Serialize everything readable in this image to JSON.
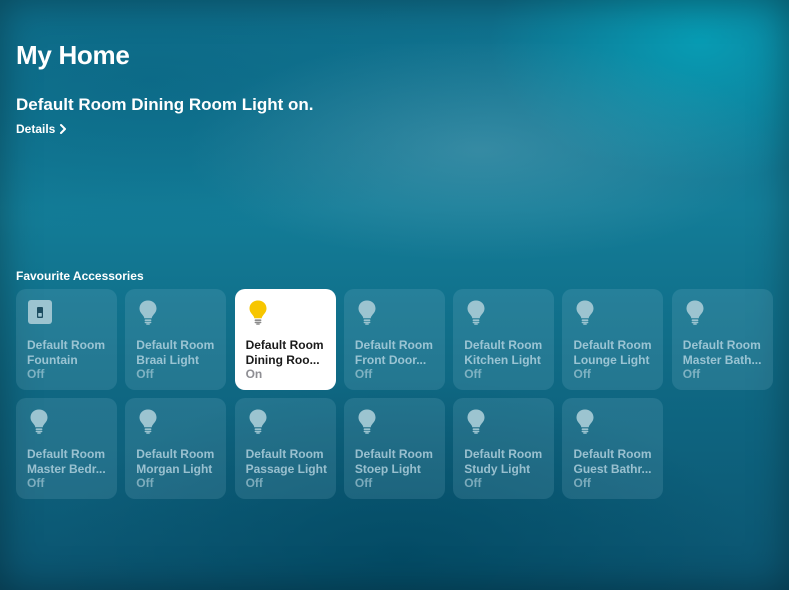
{
  "header": {
    "title": "My Home",
    "status_message": "Default Room Dining Room Light on.",
    "details_link": "Details"
  },
  "favourites": {
    "section_title": "Favourite Accessories",
    "accessories": [
      {
        "line1": "Default Room",
        "line2": "Fountain",
        "state": "Off",
        "active": false,
        "icon": "switch-icon"
      },
      {
        "line1": "Default Room",
        "line2": "Braai Light",
        "state": "Off",
        "active": false,
        "icon": "bulb-icon"
      },
      {
        "line1": "Default Room",
        "line2": "Dining Roo...",
        "state": "On",
        "active": true,
        "icon": "bulb-icon"
      },
      {
        "line1": "Default Room",
        "line2": "Front Door...",
        "state": "Off",
        "active": false,
        "icon": "bulb-icon"
      },
      {
        "line1": "Default Room",
        "line2": "Kitchen Light",
        "state": "Off",
        "active": false,
        "icon": "bulb-icon"
      },
      {
        "line1": "Default Room",
        "line2": "Lounge Light",
        "state": "Off",
        "active": false,
        "icon": "bulb-icon"
      },
      {
        "line1": "Default Room",
        "line2": "Master Bath...",
        "state": "Off",
        "active": false,
        "icon": "bulb-icon"
      },
      {
        "line1": "Default Room",
        "line2": "Master Bedr...",
        "state": "Off",
        "active": false,
        "icon": "bulb-icon"
      },
      {
        "line1": "Default Room",
        "line2": "Morgan Light",
        "state": "Off",
        "active": false,
        "icon": "bulb-icon"
      },
      {
        "line1": "Default Room",
        "line2": "Passage Light",
        "state": "Off",
        "active": false,
        "icon": "bulb-icon"
      },
      {
        "line1": "Default Room",
        "line2": "Stoep Light",
        "state": "Off",
        "active": false,
        "icon": "bulb-icon"
      },
      {
        "line1": "Default Room",
        "line2": "Study Light",
        "state": "Off",
        "active": false,
        "icon": "bulb-icon"
      },
      {
        "line1": "Default Room",
        "line2": "Guest Bathr...",
        "state": "Off",
        "active": false,
        "icon": "bulb-icon"
      }
    ]
  },
  "colors": {
    "bulb_on": "#f7c600",
    "bulb_off": "#9cc4d0",
    "switch_off": "#9cc4d0",
    "tile_on": "#ffffff"
  }
}
